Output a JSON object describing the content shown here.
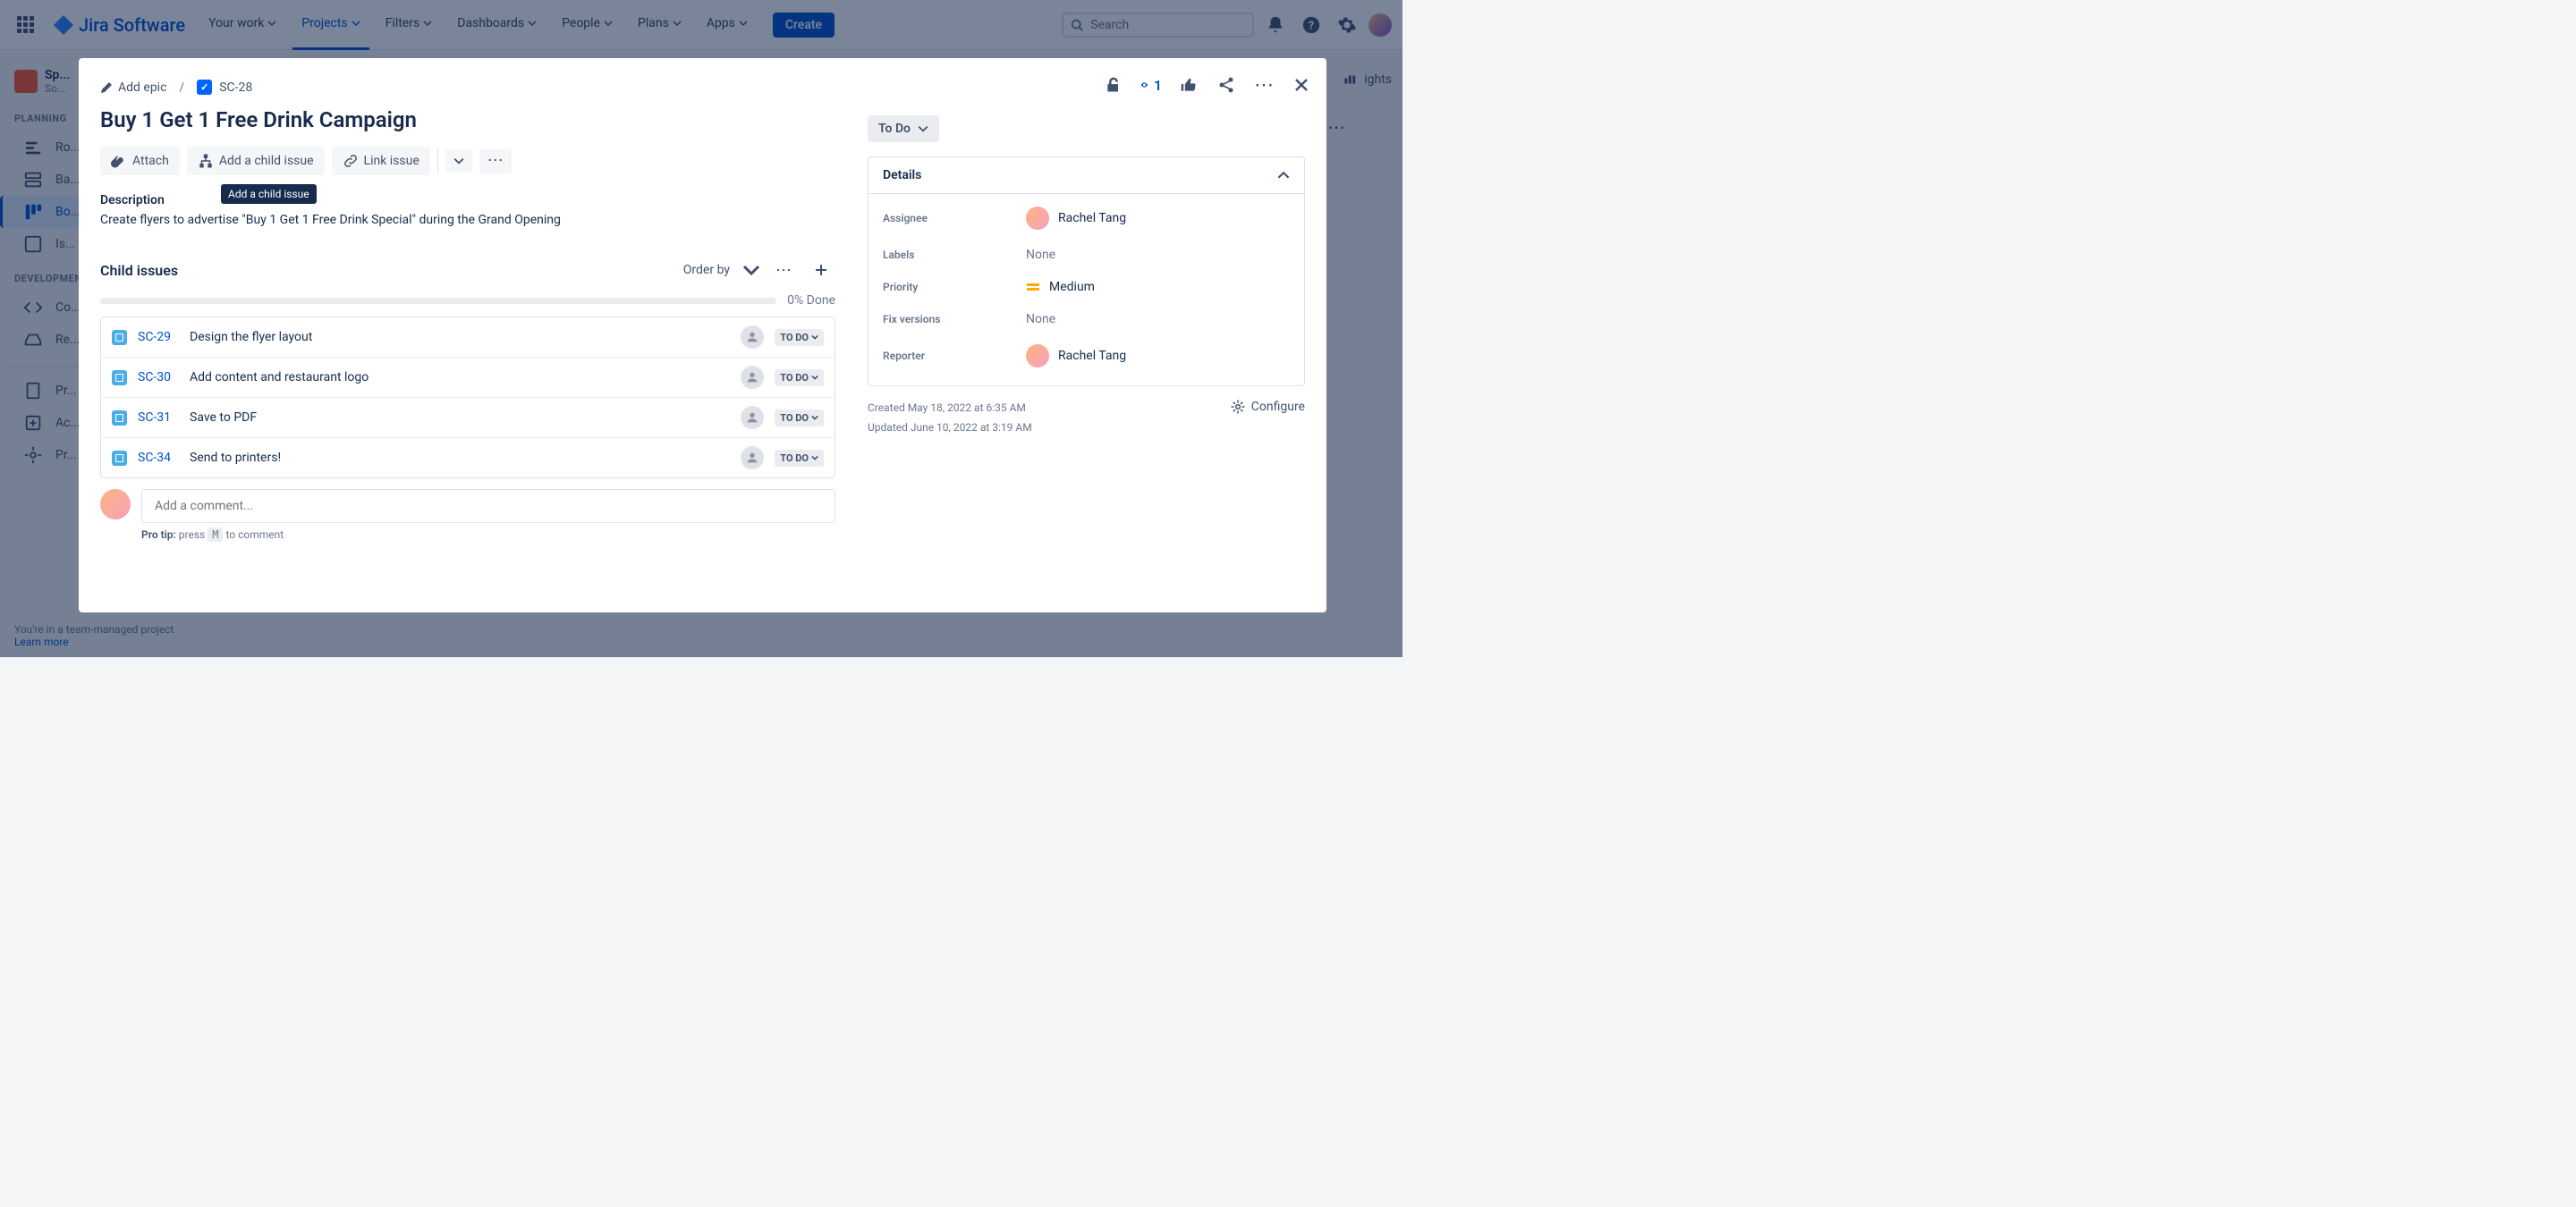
{
  "nav": {
    "logo": "Jira Software",
    "items": [
      "Your work",
      "Projects",
      "Filters",
      "Dashboards",
      "People",
      "Plans",
      "Apps"
    ],
    "active_index": 1,
    "create": "Create",
    "search_placeholder": "Search"
  },
  "sidebar": {
    "project_name": "Sp...",
    "project_type": "So...",
    "sections": {
      "planning": {
        "label": "PLANNING",
        "items": [
          "Ro...",
          "Ba...",
          "Bo...",
          "Is..."
        ]
      },
      "development": {
        "label": "DEVELOPMENT",
        "items": [
          "Co...",
          "Re..."
        ]
      },
      "other": [
        "Pr...",
        "Ac...",
        "Pr..."
      ]
    },
    "footer_text": "You're in a team-managed project",
    "footer_link": "Learn more"
  },
  "issue": {
    "add_epic": "Add epic",
    "key": "SC-28",
    "title": "Buy 1 Get 1 Free Drink Campaign",
    "actions": {
      "attach": "Attach",
      "add_child": "Add a child issue",
      "link": "Link issue"
    },
    "tooltip": "Add a child issue",
    "watch_count": "1",
    "description_label": "Description",
    "description": "Create flyers to advertise \"Buy 1 Get 1 Free Drink Special\" during the Grand Opening",
    "child_label": "Child issues",
    "order_by": "Order by",
    "progress": "0% Done",
    "children": [
      {
        "key": "SC-29",
        "summary": "Design the flyer layout",
        "status": "TO DO"
      },
      {
        "key": "SC-30",
        "summary": "Add content and restaurant logo",
        "status": "TO DO"
      },
      {
        "key": "SC-31",
        "summary": "Save to PDF",
        "status": "TO DO"
      },
      {
        "key": "SC-34",
        "summary": "Send to printers!",
        "status": "TO DO"
      }
    ],
    "comment_placeholder": "Add a comment...",
    "pro_tip_pre": "Pro tip:",
    "pro_tip_press": "press",
    "pro_tip_key": "M",
    "pro_tip_post": "to comment"
  },
  "side": {
    "status": "To Do",
    "details_label": "Details",
    "fields": {
      "assignee_label": "Assignee",
      "assignee_value": "Rachel Tang",
      "labels_label": "Labels",
      "labels_value": "None",
      "priority_label": "Priority",
      "priority_value": "Medium",
      "fixversions_label": "Fix versions",
      "fixversions_value": "None",
      "reporter_label": "Reporter",
      "reporter_value": "Rachel Tang"
    },
    "created": "Created May 18, 2022 at 6:35 AM",
    "updated": "Updated June 10, 2022 at 3:19 AM",
    "configure": "Configure"
  }
}
